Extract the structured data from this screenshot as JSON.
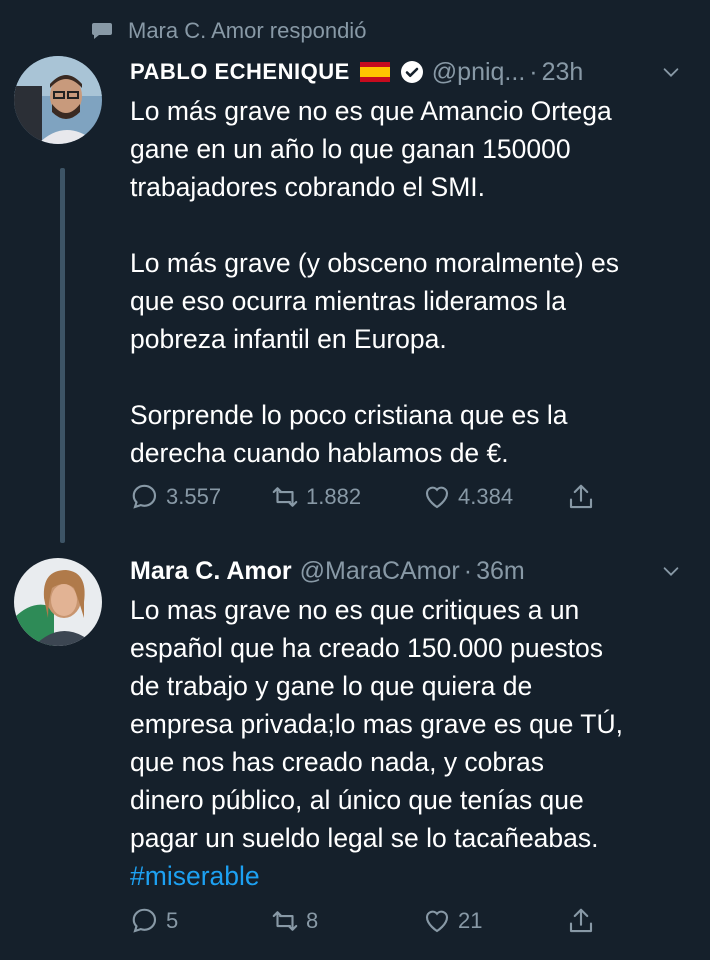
{
  "context": {
    "icon": "speech-bubble-icon",
    "text": "Mara C. Amor respondió"
  },
  "tweet1": {
    "name": "PABLO ECHENIQUE",
    "handle": "@pniq...",
    "separator": "·",
    "time": "23h",
    "flag_icon": "spain-flag-icon",
    "verified_icon": "verified-badge-icon",
    "text": "Lo más grave no es que Amancio Ortega\ngane en un año lo que ganan 150000\ntrabajadores cobrando el SMI.\n\nLo más grave (y obsceno moralmente) es\nque eso ocurra mientras lideramos la\npobreza infantil en Europa.\n\nSorprende lo poco cristiana que es la\nderecha cuando hablamos de €.",
    "replies": "3.557",
    "retweets": "1.882",
    "likes": "4.384"
  },
  "tweet2": {
    "name": "Mara C. Amor",
    "handle": "@MaraCAmor",
    "separator": "·",
    "time": "36m",
    "text": "Lo mas grave no es que critiques a un\nespañol que ha creado 150.000 puestos\nde trabajo y gane lo que quiera de\nempresa privada;lo mas grave es que TÚ,\nque nos has creado nada, y cobras\ndinero público, al único que tenías que\npagar un sueldo legal se lo tacañeabas.",
    "hashtag": "#miserable",
    "replies": "5",
    "retweets": "8",
    "likes": "21"
  },
  "colors": {
    "background": "#15202b",
    "muted": "#8899a6",
    "link": "#1da1f2",
    "thread_line": "#3d5466"
  }
}
